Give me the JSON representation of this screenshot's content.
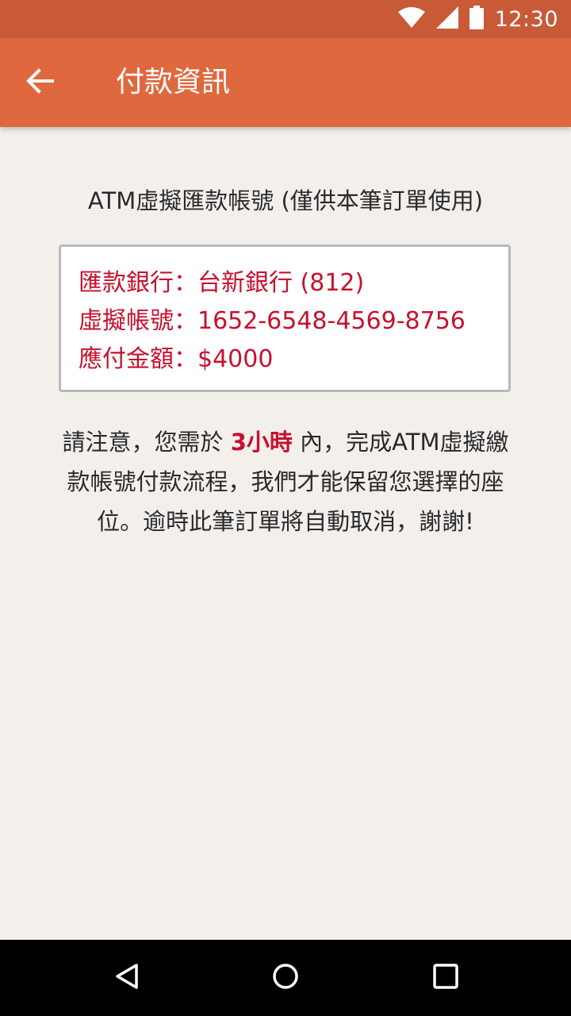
{
  "status_bar": {
    "time": "12:30",
    "icons": [
      "wifi-icon",
      "signal-icon",
      "battery-icon"
    ]
  },
  "app_bar": {
    "back_icon": "arrow-back-icon",
    "title": "付款資訊"
  },
  "section": {
    "title": "ATM虛擬匯款帳號 (僅供本筆訂單使用)"
  },
  "payment_info": {
    "bank_line": "匯款銀行：台新銀行 (812)",
    "account_line": "虛擬帳號：1652-6548-4569-8756",
    "amount_line": "應付金額：$4000"
  },
  "notice": {
    "prefix": "請注意，您需於 ",
    "highlight": "3小時",
    "suffix": " 內，完成ATM虛擬繳款帳號付款流程，我們才能保留您選擇的座位。逾時此筆訂單將自動取消，謝謝!"
  },
  "nav_bar": {
    "icons": [
      "back-triangle-icon",
      "home-circle-icon",
      "recents-square-icon"
    ]
  },
  "colors": {
    "status_bar": "#c85a38",
    "app_bar": "#e0683f",
    "background": "#f3f0ec",
    "accent_red": "#c8102e"
  }
}
